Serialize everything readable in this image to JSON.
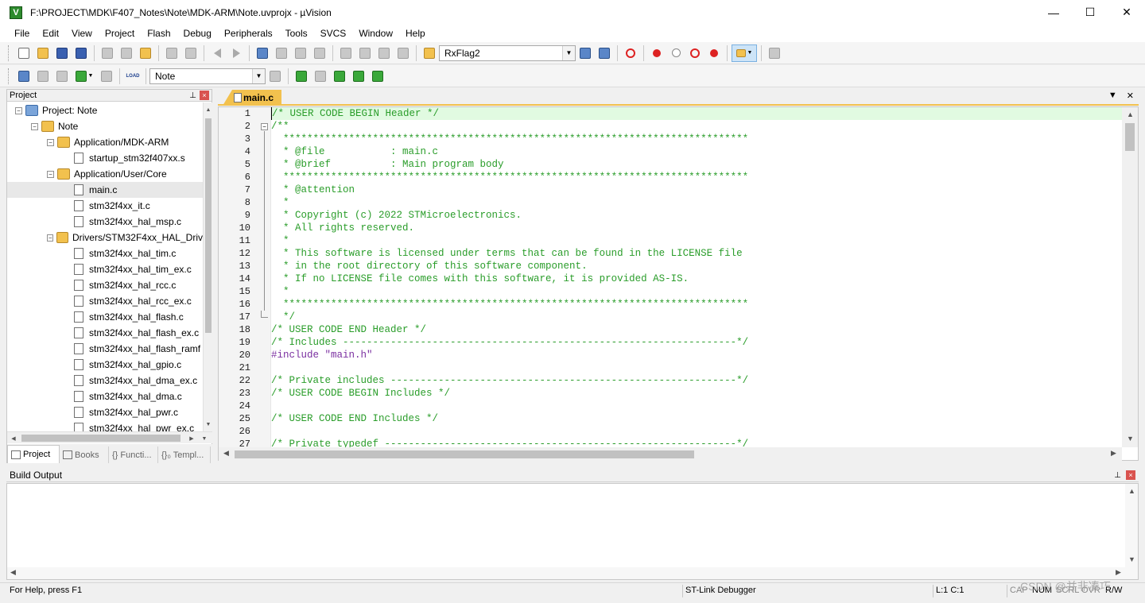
{
  "window": {
    "title": "F:\\PROJECT\\MDK\\F407_Notes\\Note\\MDK-ARM\\Note.uvprojx - µVision",
    "app_icon_letter": "V",
    "minimize": "—",
    "maximize": "☐",
    "close": "✕"
  },
  "menu": [
    "File",
    "Edit",
    "View",
    "Project",
    "Flash",
    "Debug",
    "Peripherals",
    "Tools",
    "SVCS",
    "Window",
    "Help"
  ],
  "toolbar": {
    "find_combo_value": "RxFlag2",
    "target_combo_value": "Note",
    "load_label": "LOAD"
  },
  "project_panel": {
    "title": "Project",
    "pin": "📌",
    "close": "×",
    "tree": [
      {
        "label": "Project: Note",
        "level": 0,
        "type": "proj",
        "expander": "−"
      },
      {
        "label": "Note",
        "level": 1,
        "type": "folder",
        "expander": "−"
      },
      {
        "label": "Application/MDK-ARM",
        "level": 2,
        "type": "folder",
        "expander": "−"
      },
      {
        "label": "startup_stm32f407xx.s",
        "level": 3,
        "type": "file",
        "expander": ""
      },
      {
        "label": "Application/User/Core",
        "level": 2,
        "type": "folder",
        "expander": "−"
      },
      {
        "label": "main.c",
        "level": 3,
        "type": "file",
        "expander": "",
        "selected": true
      },
      {
        "label": "stm32f4xx_it.c",
        "level": 3,
        "type": "file",
        "expander": ""
      },
      {
        "label": "stm32f4xx_hal_msp.c",
        "level": 3,
        "type": "file",
        "expander": ""
      },
      {
        "label": "Drivers/STM32F4xx_HAL_Driv",
        "level": 2,
        "type": "folder",
        "expander": "−"
      },
      {
        "label": "stm32f4xx_hal_tim.c",
        "level": 3,
        "type": "file",
        "expander": ""
      },
      {
        "label": "stm32f4xx_hal_tim_ex.c",
        "level": 3,
        "type": "file",
        "expander": ""
      },
      {
        "label": "stm32f4xx_hal_rcc.c",
        "level": 3,
        "type": "file",
        "expander": ""
      },
      {
        "label": "stm32f4xx_hal_rcc_ex.c",
        "level": 3,
        "type": "file",
        "expander": ""
      },
      {
        "label": "stm32f4xx_hal_flash.c",
        "level": 3,
        "type": "file",
        "expander": ""
      },
      {
        "label": "stm32f4xx_hal_flash_ex.c",
        "level": 3,
        "type": "file",
        "expander": ""
      },
      {
        "label": "stm32f4xx_hal_flash_ramf",
        "level": 3,
        "type": "file",
        "expander": ""
      },
      {
        "label": "stm32f4xx_hal_gpio.c",
        "level": 3,
        "type": "file",
        "expander": ""
      },
      {
        "label": "stm32f4xx_hal_dma_ex.c",
        "level": 3,
        "type": "file",
        "expander": ""
      },
      {
        "label": "stm32f4xx_hal_dma.c",
        "level": 3,
        "type": "file",
        "expander": ""
      },
      {
        "label": "stm32f4xx_hal_pwr.c",
        "level": 3,
        "type": "file",
        "expander": ""
      },
      {
        "label": "stm32f4xx_hal_pwr_ex.c",
        "level": 3,
        "type": "file",
        "expander": ""
      }
    ],
    "tabs": [
      "Project",
      "Books",
      "{} Functi...",
      "{}₀ Templ..."
    ]
  },
  "editor": {
    "tab_label": "main.c",
    "lines": [
      {
        "n": "1",
        "t": "/* USER CODE BEGIN Header */",
        "k": "c"
      },
      {
        "n": "2",
        "t": "/**",
        "k": "c"
      },
      {
        "n": "3",
        "t": "  ******************************************************************************",
        "k": "c"
      },
      {
        "n": "4",
        "t": "  * @file           : main.c",
        "k": "c"
      },
      {
        "n": "5",
        "t": "  * @brief          : Main program body",
        "k": "c"
      },
      {
        "n": "6",
        "t": "  ******************************************************************************",
        "k": "c"
      },
      {
        "n": "7",
        "t": "  * @attention",
        "k": "c"
      },
      {
        "n": "8",
        "t": "  *",
        "k": "c"
      },
      {
        "n": "9",
        "t": "  * Copyright (c) 2022 STMicroelectronics.",
        "k": "c"
      },
      {
        "n": "10",
        "t": "  * All rights reserved.",
        "k": "c"
      },
      {
        "n": "11",
        "t": "  *",
        "k": "c"
      },
      {
        "n": "12",
        "t": "  * This software is licensed under terms that can be found in the LICENSE file",
        "k": "c"
      },
      {
        "n": "13",
        "t": "  * in the root directory of this software component.",
        "k": "c"
      },
      {
        "n": "14",
        "t": "  * If no LICENSE file comes with this software, it is provided AS-IS.",
        "k": "c"
      },
      {
        "n": "15",
        "t": "  *",
        "k": "c"
      },
      {
        "n": "16",
        "t": "  ******************************************************************************",
        "k": "c"
      },
      {
        "n": "17",
        "t": "  */",
        "k": "c"
      },
      {
        "n": "18",
        "t": "/* USER CODE END Header */",
        "k": "c"
      },
      {
        "n": "19",
        "t": "/* Includes ------------------------------------------------------------------*/",
        "k": "c"
      },
      {
        "n": "20",
        "t": "#include \"main.h\"",
        "k": "pp"
      },
      {
        "n": "21",
        "t": "",
        "k": ""
      },
      {
        "n": "22",
        "t": "/* Private includes ----------------------------------------------------------*/",
        "k": "c"
      },
      {
        "n": "23",
        "t": "/* USER CODE BEGIN Includes */",
        "k": "c"
      },
      {
        "n": "24",
        "t": "",
        "k": ""
      },
      {
        "n": "25",
        "t": "/* USER CODE END Includes */",
        "k": "c"
      },
      {
        "n": "26",
        "t": "",
        "k": ""
      },
      {
        "n": "27",
        "t": "/* Private typedef -----------------------------------------------------------*/",
        "k": "c"
      }
    ]
  },
  "build_output": {
    "title": "Build Output",
    "pin": "📌",
    "close": "×"
  },
  "status": {
    "help": "For Help, press F1",
    "debugger": "ST-Link Debugger",
    "position": "L:1 C:1",
    "caps": "CAP",
    "num": "NUM",
    "scrl": "SCRL",
    "ovr": "OVR",
    "rw": "R/W"
  },
  "watermark": "CSDN @并非凑巧",
  "colors": {
    "comment": "#2a9d2a",
    "preprocessor": "#7a2fa0",
    "tab_accent": "#f2c14e",
    "current_line": "#e1fae1"
  }
}
